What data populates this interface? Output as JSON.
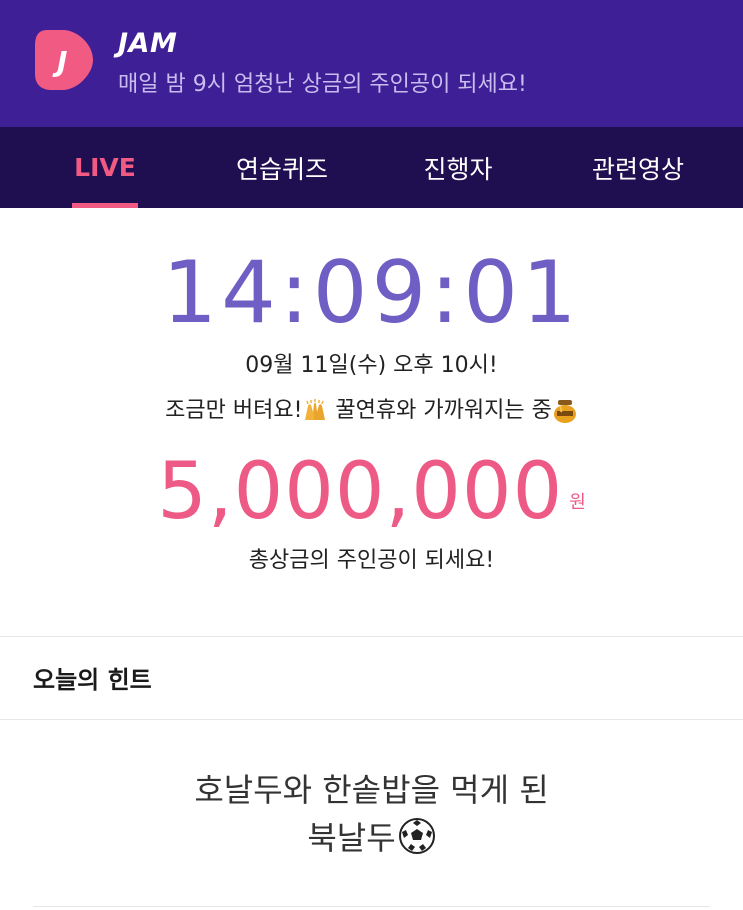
{
  "header": {
    "logo_letter": "J",
    "app_name": "JAM",
    "tagline": "매일 밤 9시 엄청난 상금의 주인공이 되세요!",
    "brand_color": "#3f1f95",
    "accent_color": "#f05a83"
  },
  "tabs": [
    {
      "label": "LIVE",
      "active": true
    },
    {
      "label": "연습퀴즈",
      "active": false
    },
    {
      "label": "진행자",
      "active": false
    },
    {
      "label": "관련영상",
      "active": false
    }
  ],
  "countdown": {
    "hours": "14",
    "minutes": "09",
    "seconds": "01",
    "separator": ":"
  },
  "schedule_text": "09월 11일(수) 오후 10시!",
  "encourage": {
    "part1": "조금만 버텨요!",
    "emoji1": "raised-hands-icon",
    "part2": " 꿀연휴와 가까워지는 중",
    "emoji2": "honey-pot-icon"
  },
  "prize": {
    "amount": "5,000,000",
    "unit": "원",
    "caption": "총상금의 주인공이 되세요!"
  },
  "hint": {
    "title": "오늘의 힌트",
    "line1": "호날두와 한솥밥을 먹게 된",
    "line2": "북날두",
    "emoji": "soccer-ball-icon"
  }
}
